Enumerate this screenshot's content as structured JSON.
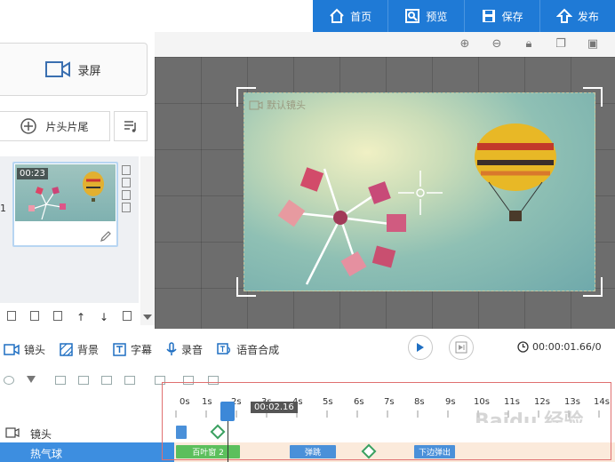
{
  "topnav": {
    "home": "首页",
    "preview": "预览",
    "save": "保存",
    "publish": "发布"
  },
  "left": {
    "record_label": "录屏",
    "trim_label": "片头片尾",
    "scene_number": "1",
    "scene_time": "00:23"
  },
  "canvas": {
    "camera_label": "默认镜头"
  },
  "timeline_tools": {
    "camera": "镜头",
    "background": "背景",
    "subtitle": "字幕",
    "record": "录音",
    "tts": "语音合成",
    "time": "00:00:01.66/0"
  },
  "timeline": {
    "ticks": [
      "0s",
      "1s",
      "2s",
      "3s",
      "4s",
      "5s",
      "6s",
      "7s",
      "8s",
      "9s",
      "10s",
      "11s",
      "12s",
      "13s",
      "14s"
    ],
    "playhead_time": "00:02.16",
    "tracks": [
      {
        "name": "镜头"
      },
      {
        "name": "热气球"
      }
    ],
    "clips": {
      "enter": "百叶窗 2",
      "bounce": "弹跳",
      "exit": "下边弹出"
    },
    "watermark": "Baidu 经验"
  },
  "colors": {
    "accent": "#1f7ad6",
    "track_highlight": "#3d8ee0",
    "clip_green": "#5cbf5c",
    "clip_blue": "#4a90d9"
  }
}
